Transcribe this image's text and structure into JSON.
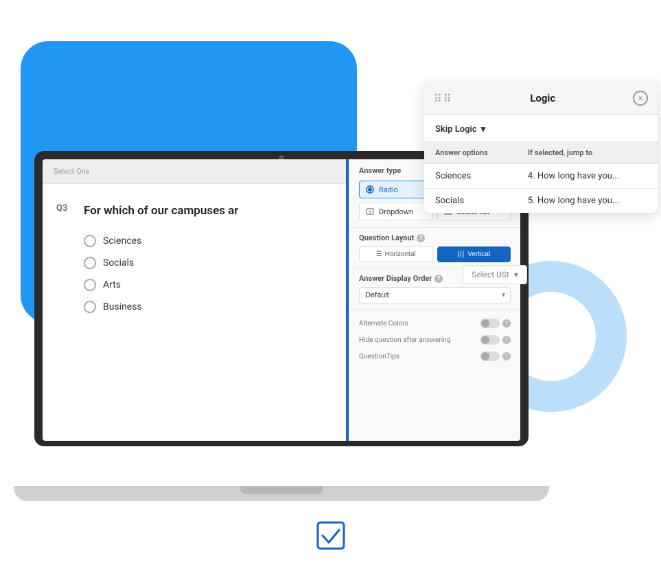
{
  "colors": {
    "blue": "#2196F3",
    "dark_blue": "#1565C0",
    "light_blue_circle": "#BBDEFB",
    "white": "#ffffff",
    "panel_bg": "#f5f5f5"
  },
  "survey": {
    "q_number": "Q3",
    "question_text": "For which of our campuses ar",
    "select_placeholder": "Select One",
    "answers": [
      {
        "label": "Sciences"
      },
      {
        "label": "Socials"
      },
      {
        "label": "Arts"
      },
      {
        "label": "Business"
      }
    ]
  },
  "settings": {
    "answer_type_label": "Answer type",
    "radio_label": "Radio",
    "dropdown_label": "Dropdown",
    "select_list_label": "Select list",
    "question_layout_label": "Question Layout",
    "horizontal_label": "Horizontal",
    "vertical_label": "Vertical",
    "answer_display_order_label": "Answer Display Order",
    "default_option": "Default",
    "alternate_colors_label": "Alternate Colors",
    "hide_question_label": "Hide question after answering",
    "question_tips_label": "QuestionTips"
  },
  "logic": {
    "title": "Logic",
    "type_label": "Skip Logic",
    "col_answers": "Answer options",
    "col_jump": "If selected, jump to",
    "rows": [
      {
        "answer": "Sciences",
        "jump": "4. How long have you..."
      },
      {
        "answer": "Socials",
        "jump": "5. How long have you..."
      }
    ],
    "select_ust_label": "Select USt"
  },
  "icons": {
    "dots_grid": "⋮⋮",
    "close": "×",
    "chevron_down": "▾",
    "check_box": "☑",
    "radio_check": "◉",
    "horizontal_lines": "☰",
    "vertical_bars": "|||",
    "dropdown_arrow": "▾"
  }
}
